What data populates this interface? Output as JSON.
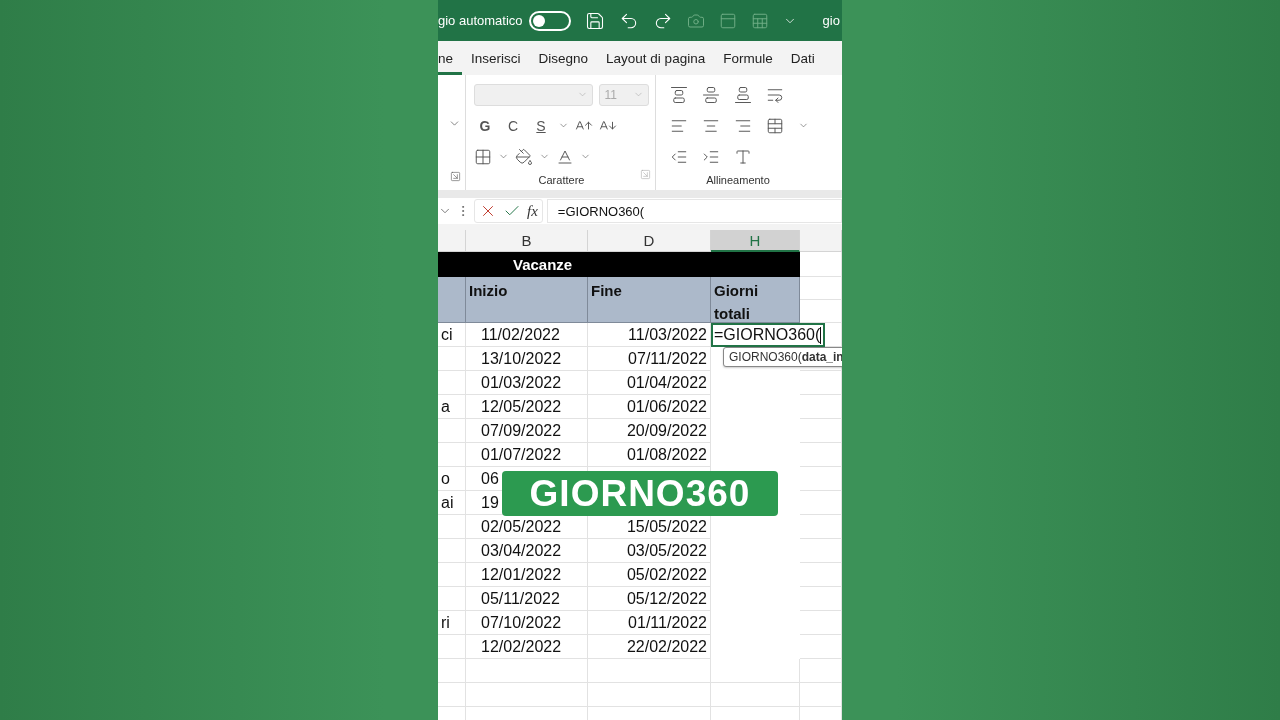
{
  "title_bar": {
    "autosave": {
      "label": "gio automatico",
      "on": false
    },
    "file_name": "gio"
  },
  "tabs": [
    {
      "label": "ne",
      "selected": true
    },
    {
      "label": "Inserisci",
      "selected": false
    },
    {
      "label": "Disegno",
      "selected": false
    },
    {
      "label": "Layout di pagina",
      "selected": false
    },
    {
      "label": "Formule",
      "selected": false
    },
    {
      "label": "Dati",
      "selected": false
    }
  ],
  "ribbon": {
    "font_size": "11",
    "format_buttons": [
      "G",
      "C",
      "S"
    ],
    "groups": [
      "Carattere",
      "Allineamento"
    ]
  },
  "formula_bar": {
    "function_label": "fx",
    "formula": "=GIORNO360("
  },
  "columns": [
    {
      "label": "B",
      "selected": false
    },
    {
      "label": "D",
      "selected": false
    },
    {
      "label": "H",
      "selected": true
    }
  ],
  "table": {
    "title": "Vacanze",
    "headers": [
      "Inizio",
      "Fine",
      "Giorni totali"
    ],
    "rows": [
      {
        "column_1": "ci",
        "start": "11/02/2022",
        "end": "11/03/2022",
        "total": "=GIORNO360(",
        "editing": true
      },
      {
        "column_1": "",
        "start": "13/10/2022",
        "end": "07/11/2022",
        "total": "",
        "editing": false
      },
      {
        "column_1": "",
        "start": "01/03/2022",
        "end": "01/04/2022",
        "total": "",
        "editing": false
      },
      {
        "column_1": "a",
        "start": "12/05/2022",
        "end": "01/06/2022",
        "total": "",
        "editing": false
      },
      {
        "column_1": "",
        "start": "07/09/2022",
        "end": "20/09/2022",
        "total": "",
        "editing": false
      },
      {
        "column_1": "",
        "start": "01/07/2022",
        "end": "01/08/2022",
        "total": "",
        "editing": false
      },
      {
        "column_1": "o",
        "start": "06"
      },
      {
        "column_1": "ai",
        "start": "19"
      },
      {
        "column_1": "",
        "start": "02/05/2022",
        "end": "15/05/2022",
        "total": "",
        "editing": false
      },
      {
        "column_1": "",
        "start": "03/04/2022",
        "end": "03/05/2022",
        "total": "",
        "editing": false
      },
      {
        "column_1": "",
        "start": "12/01/2022",
        "end": "05/02/2022",
        "total": "",
        "editing": false
      },
      {
        "column_1": "",
        "start": "05/11/2022",
        "end": "05/12/2022",
        "total": "",
        "editing": false
      },
      {
        "column_1": "ri",
        "start": "07/10/2022",
        "end": "01/11/2022",
        "total": "",
        "editing": false
      },
      {
        "column_1": "",
        "start": "12/02/2022",
        "end": "22/02/2022",
        "total": "",
        "editing": false
      }
    ]
  },
  "tooltip": "GIORNO360(**data_in**",
  "caption": "GIORNO360"
}
